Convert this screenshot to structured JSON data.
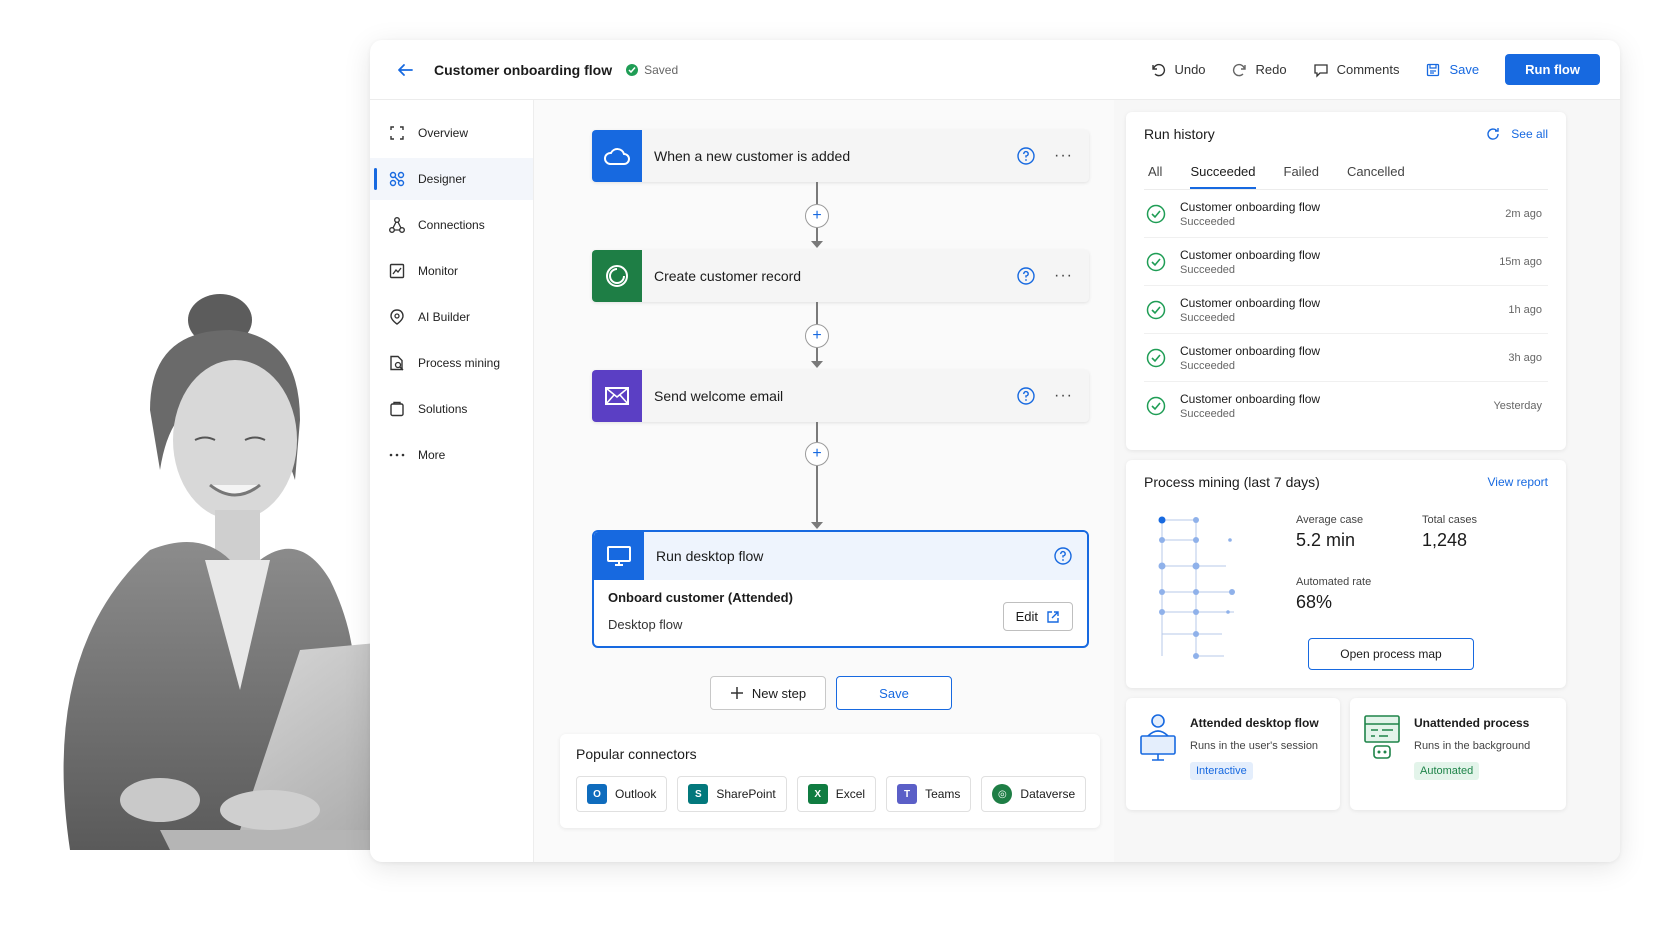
{
  "header": {
    "back_icon": "arrow-left-icon",
    "title": "Customer onboarding flow",
    "saved_label": "Saved",
    "undo_label": "Undo",
    "redo_label": "Redo",
    "comments_label": "Comments",
    "save_label": "Save",
    "run_flow_label": "Run flow",
    "accent_color": "#1769e0"
  },
  "sidebar": {
    "items": [
      {
        "label": "Overview",
        "icon": "overview-icon"
      },
      {
        "label": "Designer",
        "icon": "designer-icon",
        "active": true
      },
      {
        "label": "Connections",
        "icon": "connections-icon"
      },
      {
        "label": "Monitor",
        "icon": "monitor-icon"
      },
      {
        "label": "AI Builder",
        "icon": "ai-builder-icon"
      },
      {
        "label": "Process mining",
        "icon": "process-mining-icon"
      },
      {
        "label": "Solutions",
        "icon": "solutions-icon"
      },
      {
        "label": "More",
        "icon": "more-icon"
      }
    ]
  },
  "canvas": {
    "steps": [
      {
        "label": "When a new customer is added",
        "icon": "cloud-icon",
        "color": "#1769e0"
      },
      {
        "label": "Create customer record",
        "icon": "dataverse-icon",
        "color": "#1e7e45"
      },
      {
        "label": "Send welcome email",
        "icon": "mail-icon",
        "color": "#5b3fc4"
      }
    ],
    "desktop_step": {
      "label": "Run desktop flow",
      "icon": "desktop-icon",
      "subtitle": "Onboard customer (Attended)",
      "description": "Desktop flow",
      "edit_label": "Edit"
    },
    "new_step_label": "New step",
    "save_label": "Save",
    "popular": {
      "title": "Popular connectors",
      "connectors": [
        {
          "label": "Outlook",
          "icon": "outlook-icon",
          "color": "#0f6cbd"
        },
        {
          "label": "SharePoint",
          "icon": "sharepoint-icon",
          "color": "#03787c"
        },
        {
          "label": "Excel",
          "icon": "excel-icon",
          "color": "#107c41"
        },
        {
          "label": "Teams",
          "icon": "teams-icon",
          "color": "#5b5fc7"
        },
        {
          "label": "Dataverse",
          "icon": "dataverse-icon",
          "color": "#1e7e45"
        }
      ]
    }
  },
  "run_history": {
    "title": "Run history",
    "see_all": "See all",
    "tabs": [
      "All",
      "Succeeded",
      "Failed",
      "Cancelled"
    ],
    "active_tab": "Succeeded",
    "rows": [
      {
        "name": "Customer onboarding flow",
        "status": "Succeeded",
        "time": "2m ago"
      },
      {
        "name": "Customer onboarding flow",
        "status": "Succeeded",
        "time": "15m ago"
      },
      {
        "name": "Customer onboarding flow",
        "status": "Succeeded",
        "time": "1h ago"
      },
      {
        "name": "Customer onboarding flow",
        "status": "Succeeded",
        "time": "3h ago"
      },
      {
        "name": "Customer onboarding flow",
        "status": "Succeeded",
        "time": "Yesterday"
      }
    ],
    "success_color": "#1f9d55"
  },
  "process_mining": {
    "title": "Process mining (last 7 days)",
    "view_report": "View report",
    "average_case_label": "Average case",
    "average_case_value": "5.2 min",
    "total_cases_label": "Total cases",
    "total_cases_value": "1,248",
    "automated_rate_label": "Automated rate",
    "automated_rate_value": "68%",
    "open_map_label": "Open process map"
  },
  "modes": {
    "attended": {
      "title": "Attended desktop flow",
      "desc": "Runs in the user's session",
      "badge": "Interactive"
    },
    "unattended": {
      "title": "Unattended process",
      "desc": "Runs in the background",
      "badge": "Automated"
    }
  }
}
